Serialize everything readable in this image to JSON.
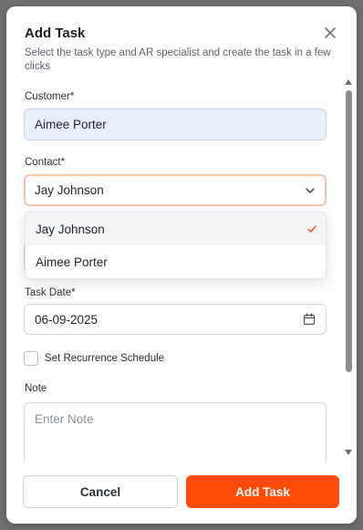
{
  "modal": {
    "title": "Add Task",
    "subtitle": "Select the task type and AR specialist and create the task in a few clicks"
  },
  "customer": {
    "label": "Customer*",
    "value": "Aimee Porter"
  },
  "contact": {
    "label": "Contact*",
    "value": "Jay Johnson",
    "options": [
      {
        "label": "Jay Johnson",
        "selected": true
      },
      {
        "label": "Aimee Porter",
        "selected": false
      }
    ]
  },
  "task_date": {
    "label": "Task Date*",
    "value": "06-09-2025"
  },
  "recurrence": {
    "label": "Set Recurrence Schedule",
    "checked": false
  },
  "note": {
    "label": "Note",
    "placeholder": "Enter Note"
  },
  "buttons": {
    "cancel": "Cancel",
    "add": "Add Task"
  },
  "colors": {
    "accent": "#ff4b0a",
    "check": "#ff4b0a",
    "customer_bg": "#e8effd",
    "focus_border": "#f7c6aa"
  },
  "icons": {
    "close": "close-icon",
    "chevron": "chevron-down-icon",
    "calendar": "calendar-icon",
    "check": "check-icon"
  }
}
